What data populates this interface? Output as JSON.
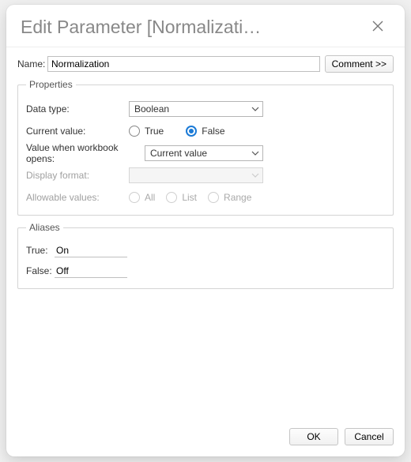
{
  "dialog": {
    "title": "Edit Parameter [Normalizati…"
  },
  "name_row": {
    "label": "Name:",
    "value": "Normalization",
    "comment_btn": "Comment >>"
  },
  "properties": {
    "legend": "Properties",
    "data_type": {
      "label": "Data type:",
      "value": "Boolean"
    },
    "current_value": {
      "label": "Current value:",
      "options": {
        "true": "True",
        "false": "False"
      },
      "selected": "false"
    },
    "when_open": {
      "label": "Value when workbook opens:",
      "value": "Current value"
    },
    "display_format": {
      "label": "Display format:",
      "value": ""
    },
    "allowable": {
      "label": "Allowable values:",
      "options": {
        "all": "All",
        "list": "List",
        "range": "Range"
      }
    }
  },
  "aliases": {
    "legend": "Aliases",
    "true": {
      "label": "True:",
      "value": "On"
    },
    "false": {
      "label": "False:",
      "value": "Off"
    }
  },
  "footer": {
    "ok": "OK",
    "cancel": "Cancel"
  }
}
